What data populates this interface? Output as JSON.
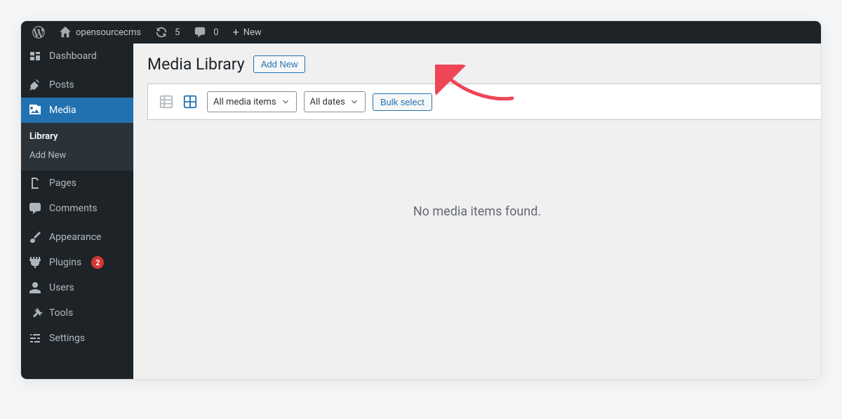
{
  "adminbar": {
    "site_name": "opensourcecms",
    "updates_count": "5",
    "comments_count": "0",
    "new_label": "New"
  },
  "sidebar": {
    "items": [
      {
        "label": "Dashboard",
        "icon": "dashboard"
      },
      {
        "label": "Posts",
        "icon": "pin"
      },
      {
        "label": "Media",
        "icon": "media"
      },
      {
        "label": "Pages",
        "icon": "pages"
      },
      {
        "label": "Comments",
        "icon": "comment"
      },
      {
        "label": "Appearance",
        "icon": "brush"
      },
      {
        "label": "Plugins",
        "icon": "plug",
        "badge": "2"
      },
      {
        "label": "Users",
        "icon": "user"
      },
      {
        "label": "Tools",
        "icon": "wrench"
      },
      {
        "label": "Settings",
        "icon": "sliders"
      }
    ],
    "submenu": {
      "library": "Library",
      "add_new": "Add New"
    }
  },
  "page": {
    "title": "Media Library",
    "add_new_btn": "Add New",
    "filter_media": "All media items",
    "filter_dates": "All dates",
    "bulk_select": "Bulk select",
    "empty": "No media items found."
  }
}
